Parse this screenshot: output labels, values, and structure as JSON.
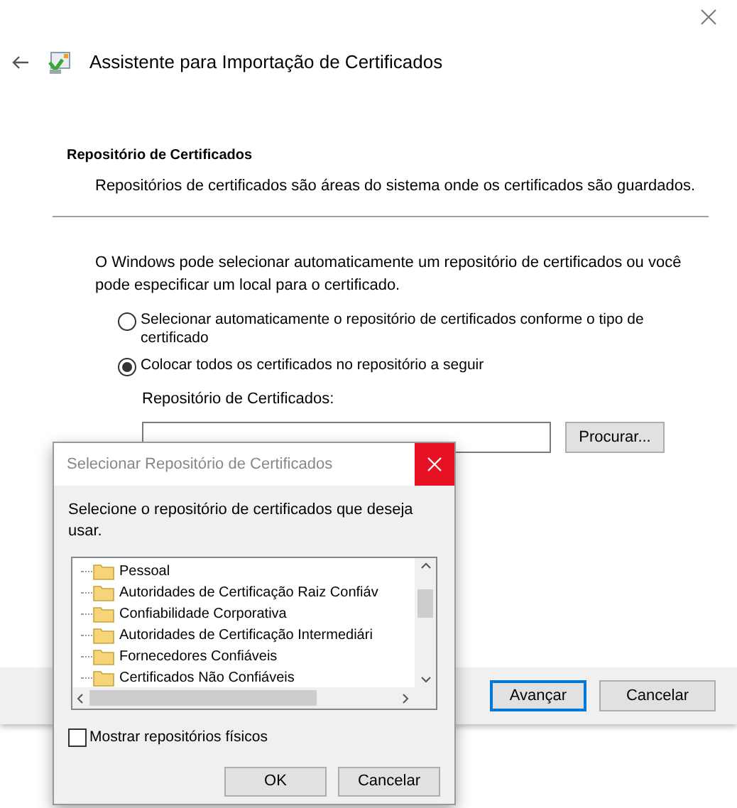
{
  "window": {
    "title": "Assistente para Importação de Certificados"
  },
  "section": {
    "heading": "Repositório de Certificados",
    "description": "Repositórios de certificados são áreas do sistema onde os certificados são guardados."
  },
  "intro": "O Windows pode selecionar automaticamente um repositório de certificados ou você pode especificar um local para o certificado.",
  "options": [
    {
      "label": "Selecionar automaticamente o repositório de certificados conforme o tipo de certificado",
      "selected": false
    },
    {
      "label": "Colocar todos os certificados no repositório a seguir",
      "selected": true
    }
  ],
  "store_field": {
    "label": "Repositório de Certificados:",
    "button": "Procurar..."
  },
  "footer_buttons": [
    {
      "label": "Avançar",
      "default": true
    },
    {
      "label": "Cancelar",
      "default": false
    }
  ],
  "dialog": {
    "title": "Selecionar Repositório de Certificados",
    "prompt": "Selecione o repositório de certificados que deseja usar.",
    "tree": [
      {
        "label": "Pessoal"
      },
      {
        "label": "Autoridades de Certificação Raiz Confiáv"
      },
      {
        "label": "Confiabilidade Corporativa"
      },
      {
        "label": "Autoridades de Certificação Intermediári"
      },
      {
        "label": "Fornecedores Confiáveis"
      },
      {
        "label": "Certificados Não Confiáveis"
      }
    ],
    "checkbox": {
      "label": "Mostrar repositórios físicos",
      "checked": false
    },
    "buttons": [
      {
        "label": "OK"
      },
      {
        "label": "Cancelar"
      }
    ]
  }
}
